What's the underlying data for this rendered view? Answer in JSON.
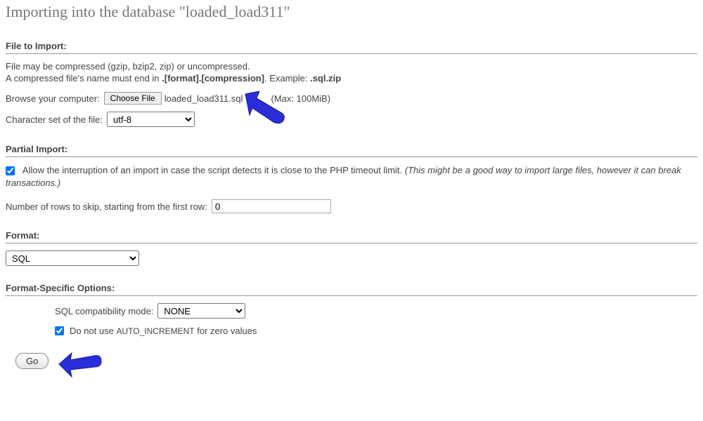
{
  "page_title": "Importing into the database \"loaded_load311\"",
  "file_to_import": {
    "heading": "File to Import:",
    "hint1": "File may be compressed (gzip, bzip2, zip) or uncompressed.",
    "hint2_pre": "A compressed file's name must end in ",
    "hint2_bold": ".[format].[compression]",
    "hint2_mid": ". Example: ",
    "hint2_example": ".sql.zip",
    "browse_label": "Browse your computer:",
    "choose_file_btn": "Choose File",
    "filename": "loaded_load311.sql",
    "max_size": "(Max: 100MiB)",
    "charset_label": "Character set of the file:",
    "charset_value": "utf-8"
  },
  "partial_import": {
    "heading": "Partial Import:",
    "allow_interrupt_checked": true,
    "allow_interrupt_text": "Allow the interruption of an import in case the script detects it is close to the PHP timeout limit. ",
    "allow_interrupt_note": "(This might be a good way to import large files, however it can break transactions.)",
    "skip_label": "Number of rows to skip, starting from the first row:",
    "skip_value": "0"
  },
  "format": {
    "heading": "Format:",
    "value": "SQL"
  },
  "format_specific": {
    "heading": "Format-Specific Options:",
    "compat_label": "SQL compatibility mode:",
    "compat_value": "NONE",
    "ai_checked": true,
    "ai_text_pre": "Do not use ",
    "ai_text_code": "AUTO_INCREMENT",
    "ai_text_post": " for zero values"
  },
  "go_button": "Go"
}
